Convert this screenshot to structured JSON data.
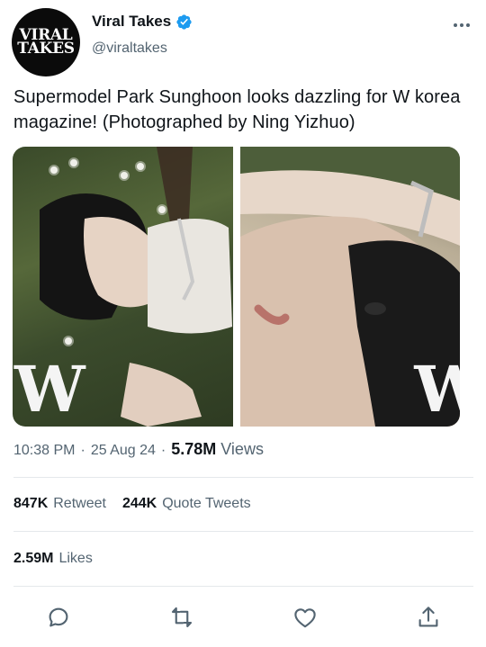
{
  "account": {
    "avatar_line1": "VIRAL",
    "avatar_line2": "TAKES",
    "display_name": "Viral Takes",
    "handle": "@viraltakes",
    "verified": true
  },
  "tweet": {
    "text": "Supermodel Park Sunghoon looks dazzling for W korea magazine! (Photographed by Ning Yizhuo)",
    "media_mark_left": "W",
    "media_mark_right": "W"
  },
  "meta": {
    "time": "10:38 PM",
    "separator": "·",
    "date": "25 Aug 24",
    "views_count": "5.78M",
    "views_label": "Views"
  },
  "stats": {
    "retweets_count": "847K",
    "retweets_label": "Retweet",
    "quotes_count": "244K",
    "quotes_label": "Quote Tweets",
    "likes_count": "2.59M",
    "likes_label": "Likes"
  },
  "colors": {
    "text_primary": "#0f1419",
    "text_secondary": "#536471",
    "verified_blue": "#1d9bf0",
    "divider": "#e4e8eb"
  },
  "icons": {
    "reply": "speech-bubble-icon",
    "retweet": "retweet-arrows-icon",
    "like": "heart-icon",
    "share": "share-upload-icon",
    "more": "more-dots-icon",
    "verified": "verified-badge-icon"
  }
}
